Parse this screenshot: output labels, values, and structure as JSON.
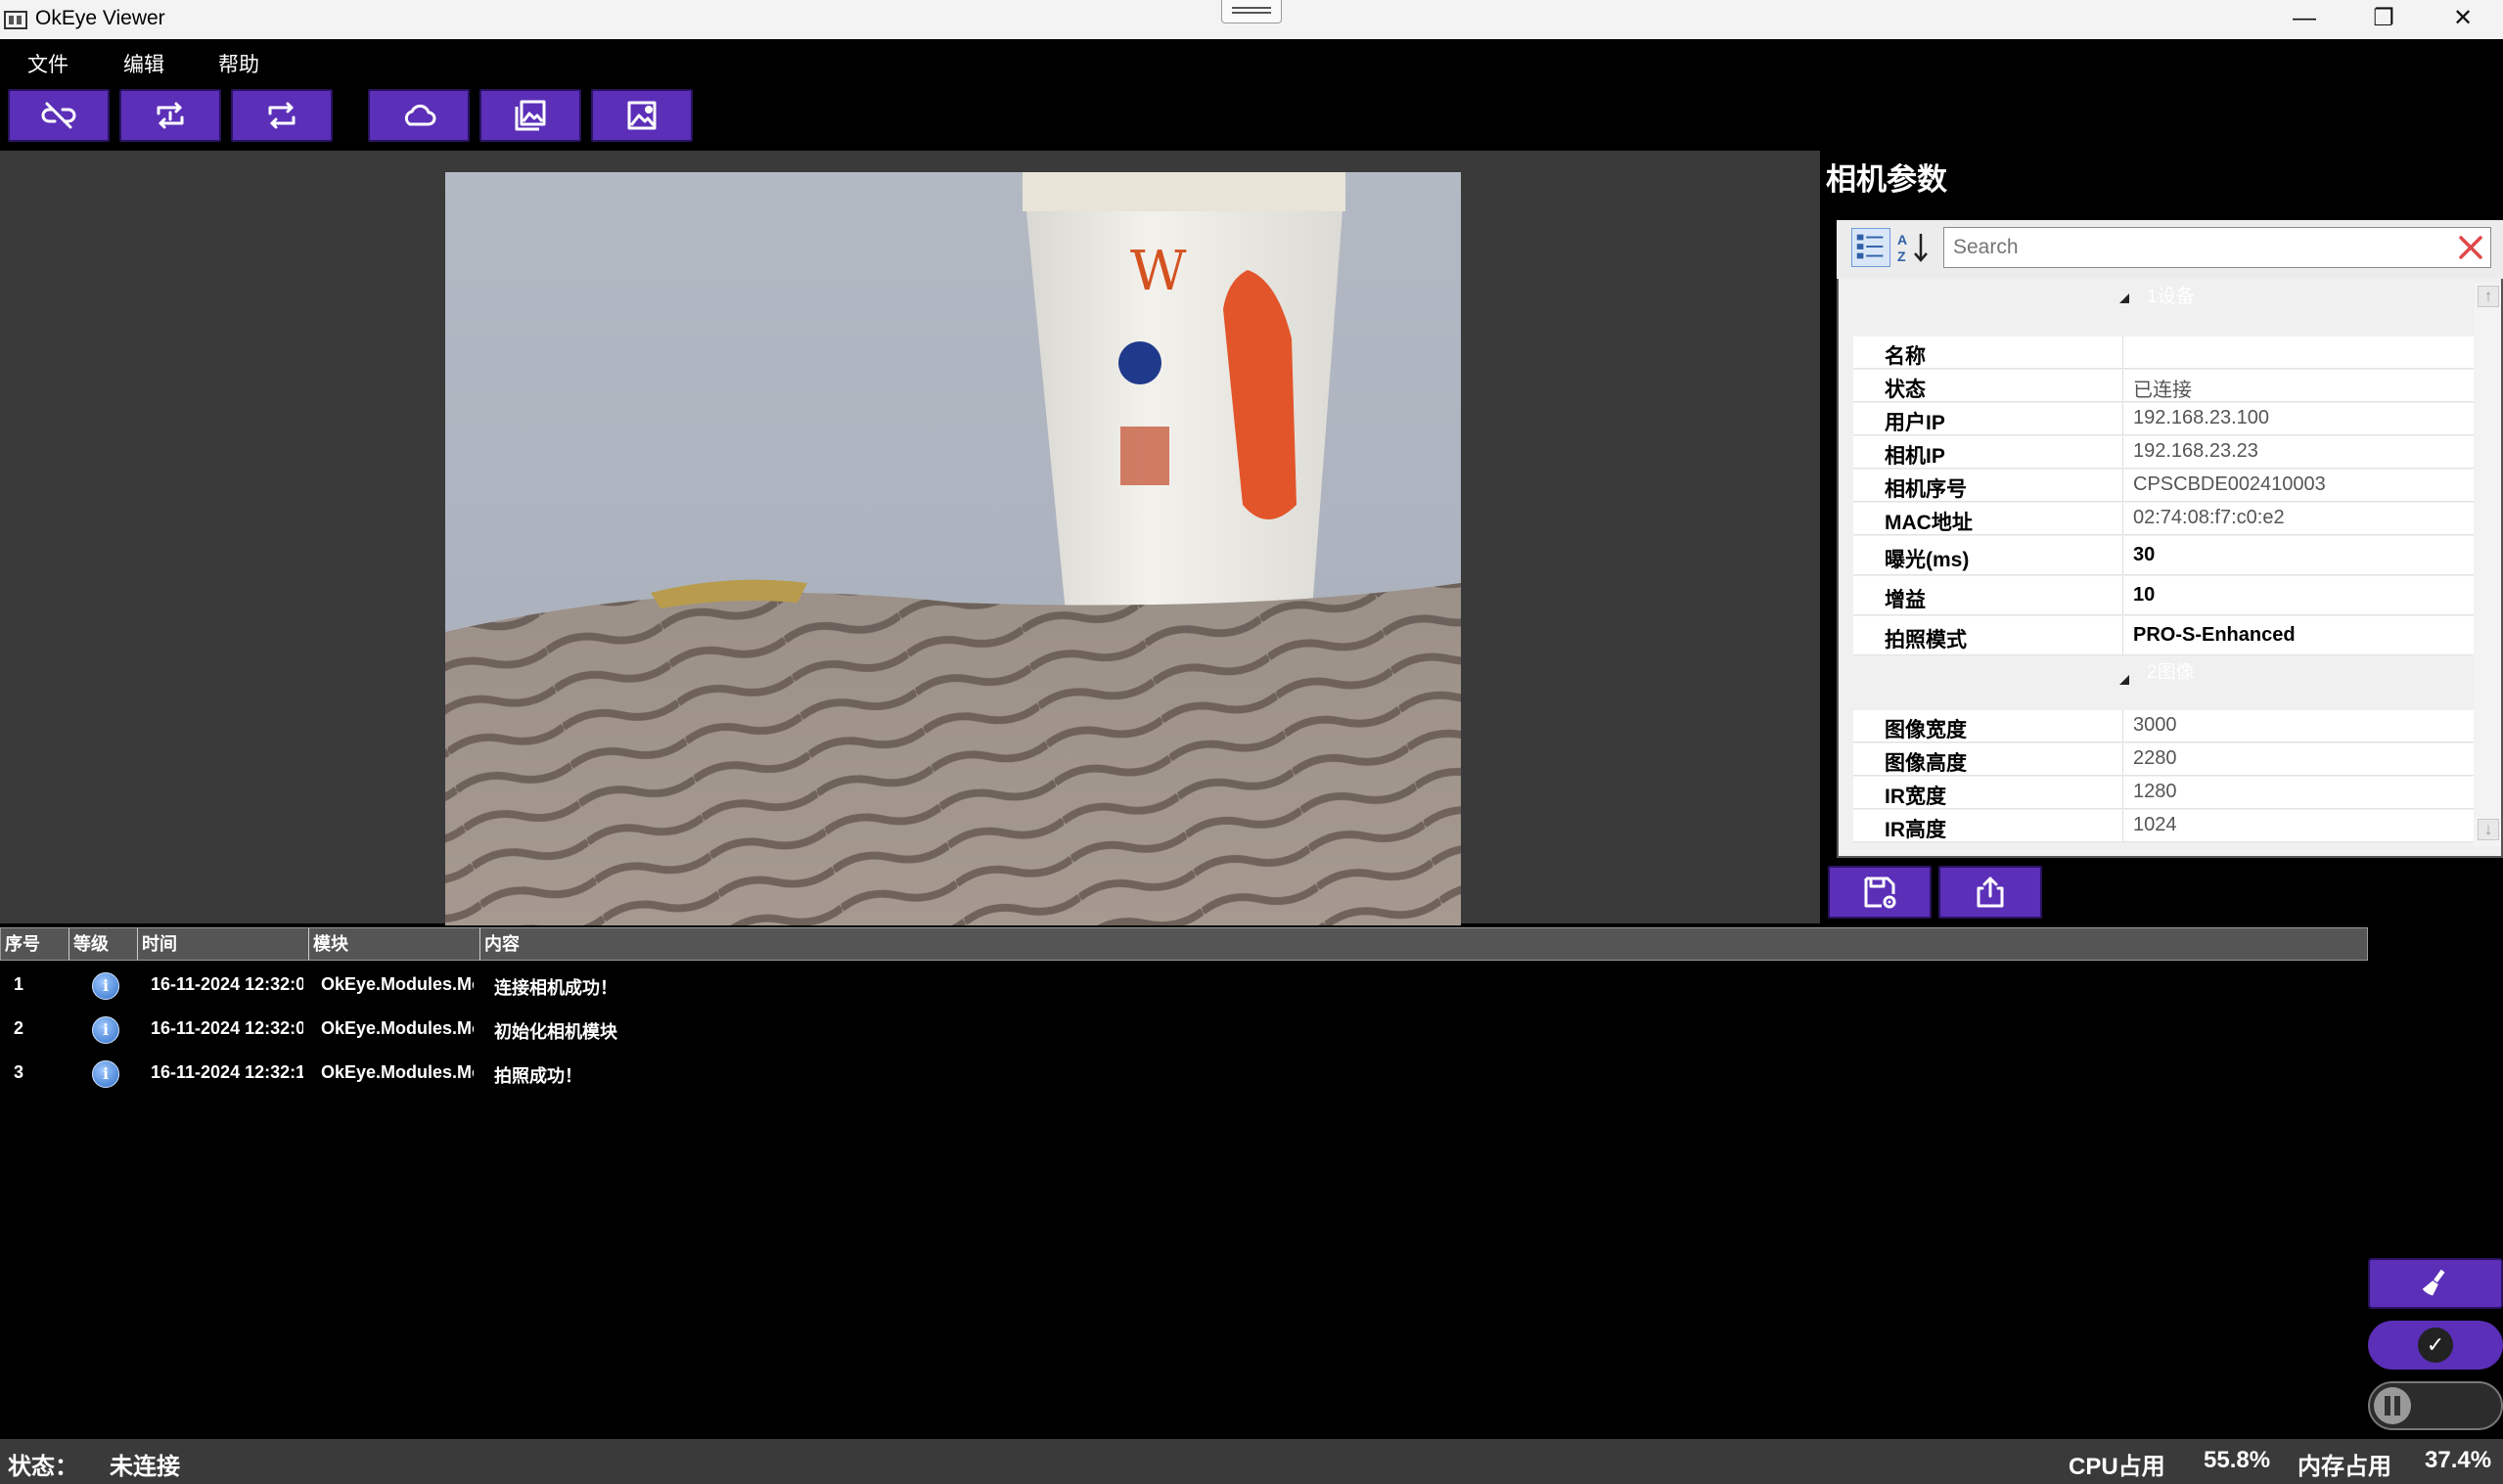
{
  "window": {
    "title": "OkEye Viewer",
    "minimize_glyph": "—",
    "restore_glyph": "❐",
    "close_glyph": "✕"
  },
  "menu": [
    "文件",
    "编辑",
    "帮助"
  ],
  "toolbar": {
    "buttons": [
      "disconnect-icon",
      "single-capture-icon",
      "continuous-capture-icon",
      "cloud-icon",
      "gallery-icon",
      "image-icon"
    ]
  },
  "panel": {
    "title": "相机参数",
    "search_placeholder": "Search",
    "categories": [
      {
        "label": "1设备",
        "rows": [
          {
            "name": "名称",
            "value": "",
            "editable": false
          },
          {
            "name": "状态",
            "value": "已连接",
            "editable": false
          },
          {
            "name": "用户IP",
            "value": "192.168.23.100",
            "editable": false
          },
          {
            "name": "相机IP",
            "value": "192.168.23.23",
            "editable": false
          },
          {
            "name": "相机序号",
            "value": "CPSCBDE002410003",
            "editable": false
          },
          {
            "name": "MAC地址",
            "value": "02:74:08:f7:c0:e2",
            "editable": false
          },
          {
            "name": "曝光(ms)",
            "value": "30",
            "editable": true
          },
          {
            "name": "增益",
            "value": "10",
            "editable": true
          },
          {
            "name": "拍照模式",
            "value": "PRO-S-Enhanced",
            "editable": true
          }
        ]
      },
      {
        "label": "2图像",
        "rows": [
          {
            "name": "图像宽度",
            "value": "3000",
            "editable": false
          },
          {
            "name": "图像高度",
            "value": "2280",
            "editable": false
          },
          {
            "name": "IR宽度",
            "value": "1280",
            "editable": false
          },
          {
            "name": "IR高度",
            "value": "1024",
            "editable": false
          }
        ]
      }
    ]
  },
  "log": {
    "columns": [
      "序号",
      "等级",
      "时间",
      "模块",
      "内容"
    ],
    "rows": [
      {
        "index": "1",
        "level": "info",
        "time": "16-11-2024 12:32:0",
        "module": "OkEye.Modules.Mo",
        "content": "连接相机成功！"
      },
      {
        "index": "2",
        "level": "info",
        "time": "16-11-2024 12:32:0",
        "module": "OkEye.Modules.Mo",
        "content": "初始化相机模块"
      },
      {
        "index": "3",
        "level": "info",
        "time": "16-11-2024 12:32:1",
        "module": "OkEye.Modules.Mo",
        "content": "拍照成功！"
      }
    ]
  },
  "status": {
    "label": "状态：",
    "value": "未连接",
    "cpu_label": "CPU占用",
    "cpu_value": "55.8%",
    "mem_label": "内存占用",
    "mem_value": "37.4%"
  },
  "colors": {
    "accent": "#5b2fb8",
    "background": "#000000",
    "viewer_bg": "#3a3a3a"
  }
}
